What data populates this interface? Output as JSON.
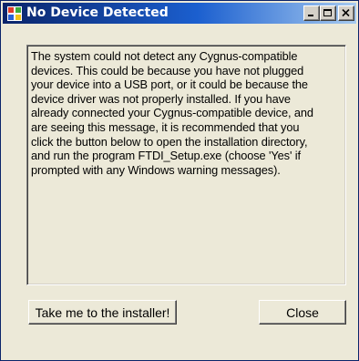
{
  "window": {
    "title": "No Device Detected",
    "app_icon": "windows-app-icon",
    "controls": {
      "minimize": "minimize-icon",
      "maximize": "maximize-icon",
      "close": "close-icon"
    }
  },
  "message": {
    "lines": [
      "The system could not detect any Cygnus-compatible",
      "devices. This could be because you have not plugged",
      "your device into a USB port, or it could be because the",
      "device driver was not properly installed.  If you have",
      "already connected your Cygnus-compatible device, and",
      "are seeing this message, it is recommended that you",
      "click the button below to open the installation directory,",
      "and run the program FTDI_Setup.exe (choose 'Yes' if",
      "prompted with any Windows warning messages)."
    ]
  },
  "buttons": {
    "installer_label": "Take me to the installer!",
    "close_label": "Close"
  },
  "colors": {
    "titlebar_start": "#0a246a",
    "titlebar_end": "#a6caf0",
    "window_background": "#ece9d8"
  }
}
